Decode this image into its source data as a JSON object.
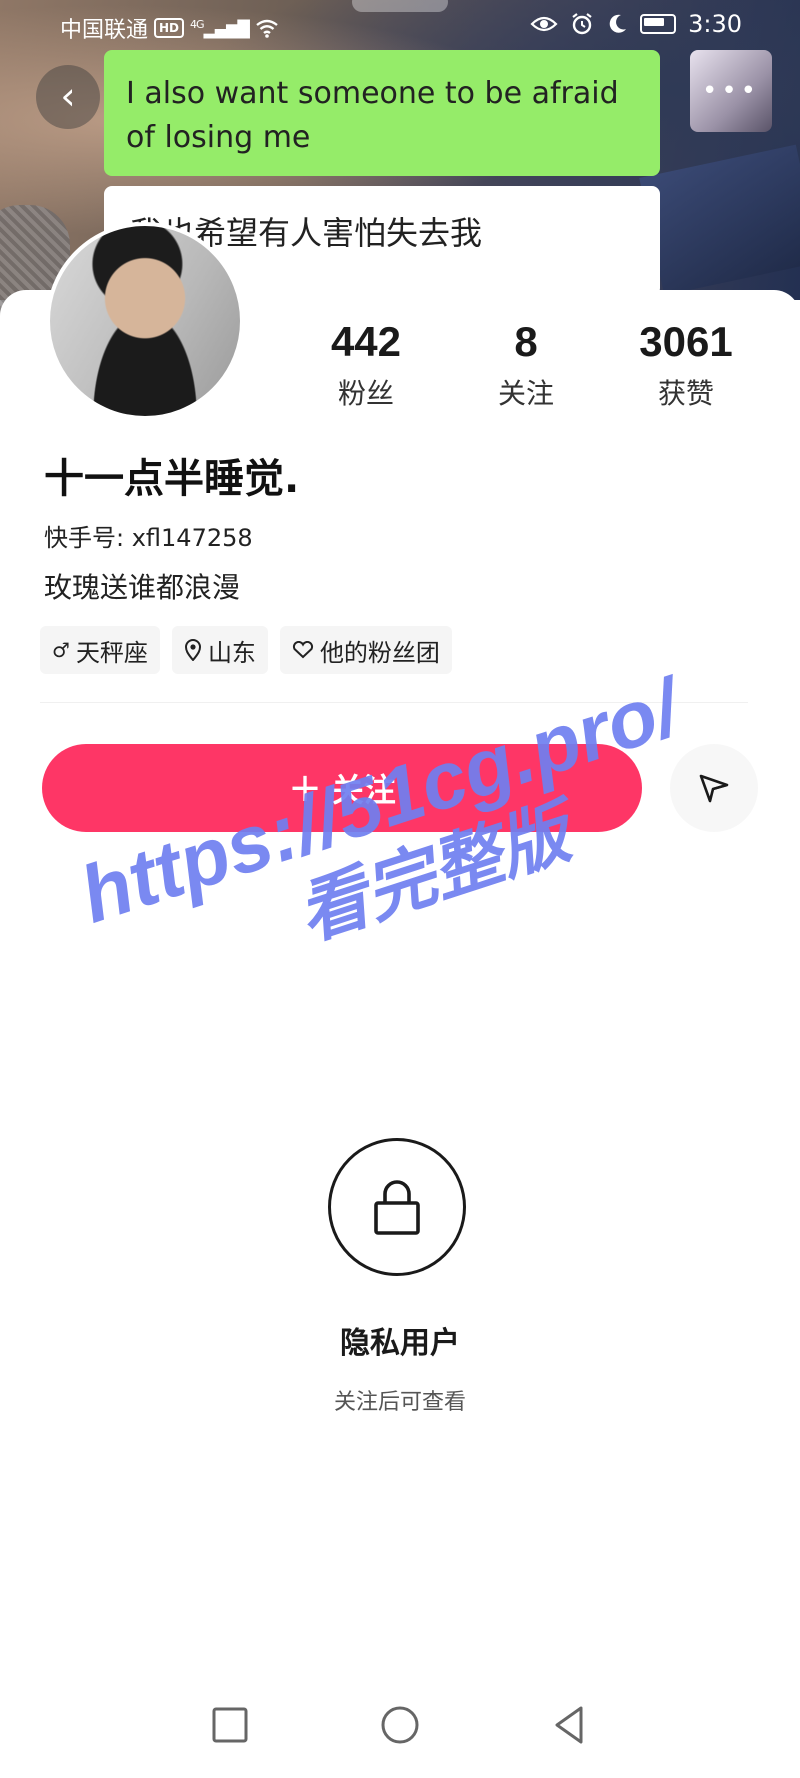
{
  "status_bar": {
    "carrier": "中国联通",
    "hd": "HD",
    "network": "4G",
    "time": "3:30",
    "icons": [
      "eye-icon",
      "alarm-icon",
      "moon-icon",
      "battery-icon"
    ]
  },
  "chat": {
    "message_english": "I also want someone to be afraid of losing me",
    "message_chinese": "我也希望有人害怕失去我"
  },
  "profile": {
    "followers_count": "442",
    "followers_label": "粉丝",
    "following_count": "8",
    "following_label": "关注",
    "likes_count": "3061",
    "likes_label": "获赞",
    "nickname": "十一点半睡觉.",
    "user_id": "快手号: xfl147258",
    "signature": "玫瑰送谁都浪漫",
    "tags": [
      {
        "icon": "male-icon",
        "label": "天秤座"
      },
      {
        "icon": "location-icon",
        "label": "山东"
      },
      {
        "icon": "heart-icon",
        "label": "他的粉丝团"
      }
    ]
  },
  "actions": {
    "follow_label": "关注",
    "follow_color": "#fe3666"
  },
  "watermark": {
    "line1": "https://51cg.pro/",
    "line2": "看完整版",
    "color": "#6f7ff0"
  },
  "private_section": {
    "title": "隐私用户",
    "subtitle": "关注后可查看"
  },
  "nav": [
    "square-icon",
    "circle-icon",
    "triangle-back-icon"
  ]
}
